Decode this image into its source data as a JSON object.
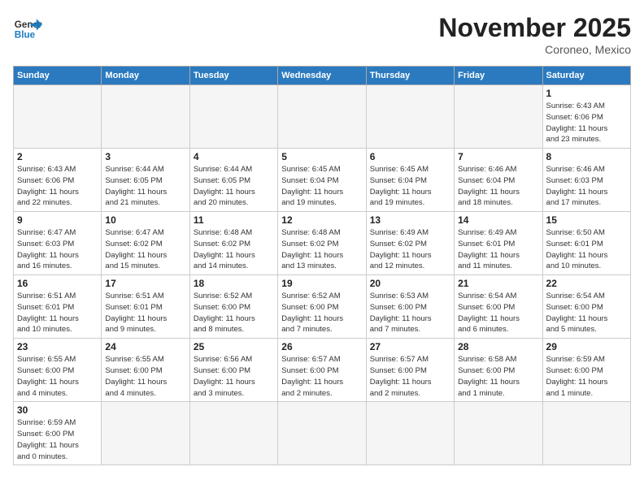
{
  "header": {
    "logo_general": "General",
    "logo_blue": "Blue",
    "month_title": "November 2025",
    "location": "Coroneo, Mexico"
  },
  "days_of_week": [
    "Sunday",
    "Monday",
    "Tuesday",
    "Wednesday",
    "Thursday",
    "Friday",
    "Saturday"
  ],
  "weeks": [
    [
      {
        "day": "",
        "info": ""
      },
      {
        "day": "",
        "info": ""
      },
      {
        "day": "",
        "info": ""
      },
      {
        "day": "",
        "info": ""
      },
      {
        "day": "",
        "info": ""
      },
      {
        "day": "",
        "info": ""
      },
      {
        "day": "1",
        "info": "Sunrise: 6:43 AM\nSunset: 6:06 PM\nDaylight: 11 hours\nand 23 minutes."
      }
    ],
    [
      {
        "day": "2",
        "info": "Sunrise: 6:43 AM\nSunset: 6:06 PM\nDaylight: 11 hours\nand 22 minutes."
      },
      {
        "day": "3",
        "info": "Sunrise: 6:44 AM\nSunset: 6:05 PM\nDaylight: 11 hours\nand 21 minutes."
      },
      {
        "day": "4",
        "info": "Sunrise: 6:44 AM\nSunset: 6:05 PM\nDaylight: 11 hours\nand 20 minutes."
      },
      {
        "day": "5",
        "info": "Sunrise: 6:45 AM\nSunset: 6:04 PM\nDaylight: 11 hours\nand 19 minutes."
      },
      {
        "day": "6",
        "info": "Sunrise: 6:45 AM\nSunset: 6:04 PM\nDaylight: 11 hours\nand 19 minutes."
      },
      {
        "day": "7",
        "info": "Sunrise: 6:46 AM\nSunset: 6:04 PM\nDaylight: 11 hours\nand 18 minutes."
      },
      {
        "day": "8",
        "info": "Sunrise: 6:46 AM\nSunset: 6:03 PM\nDaylight: 11 hours\nand 17 minutes."
      }
    ],
    [
      {
        "day": "9",
        "info": "Sunrise: 6:47 AM\nSunset: 6:03 PM\nDaylight: 11 hours\nand 16 minutes."
      },
      {
        "day": "10",
        "info": "Sunrise: 6:47 AM\nSunset: 6:02 PM\nDaylight: 11 hours\nand 15 minutes."
      },
      {
        "day": "11",
        "info": "Sunrise: 6:48 AM\nSunset: 6:02 PM\nDaylight: 11 hours\nand 14 minutes."
      },
      {
        "day": "12",
        "info": "Sunrise: 6:48 AM\nSunset: 6:02 PM\nDaylight: 11 hours\nand 13 minutes."
      },
      {
        "day": "13",
        "info": "Sunrise: 6:49 AM\nSunset: 6:02 PM\nDaylight: 11 hours\nand 12 minutes."
      },
      {
        "day": "14",
        "info": "Sunrise: 6:49 AM\nSunset: 6:01 PM\nDaylight: 11 hours\nand 11 minutes."
      },
      {
        "day": "15",
        "info": "Sunrise: 6:50 AM\nSunset: 6:01 PM\nDaylight: 11 hours\nand 10 minutes."
      }
    ],
    [
      {
        "day": "16",
        "info": "Sunrise: 6:51 AM\nSunset: 6:01 PM\nDaylight: 11 hours\nand 10 minutes."
      },
      {
        "day": "17",
        "info": "Sunrise: 6:51 AM\nSunset: 6:01 PM\nDaylight: 11 hours\nand 9 minutes."
      },
      {
        "day": "18",
        "info": "Sunrise: 6:52 AM\nSunset: 6:00 PM\nDaylight: 11 hours\nand 8 minutes."
      },
      {
        "day": "19",
        "info": "Sunrise: 6:52 AM\nSunset: 6:00 PM\nDaylight: 11 hours\nand 7 minutes."
      },
      {
        "day": "20",
        "info": "Sunrise: 6:53 AM\nSunset: 6:00 PM\nDaylight: 11 hours\nand 7 minutes."
      },
      {
        "day": "21",
        "info": "Sunrise: 6:54 AM\nSunset: 6:00 PM\nDaylight: 11 hours\nand 6 minutes."
      },
      {
        "day": "22",
        "info": "Sunrise: 6:54 AM\nSunset: 6:00 PM\nDaylight: 11 hours\nand 5 minutes."
      }
    ],
    [
      {
        "day": "23",
        "info": "Sunrise: 6:55 AM\nSunset: 6:00 PM\nDaylight: 11 hours\nand 4 minutes."
      },
      {
        "day": "24",
        "info": "Sunrise: 6:55 AM\nSunset: 6:00 PM\nDaylight: 11 hours\nand 4 minutes."
      },
      {
        "day": "25",
        "info": "Sunrise: 6:56 AM\nSunset: 6:00 PM\nDaylight: 11 hours\nand 3 minutes."
      },
      {
        "day": "26",
        "info": "Sunrise: 6:57 AM\nSunset: 6:00 PM\nDaylight: 11 hours\nand 2 minutes."
      },
      {
        "day": "27",
        "info": "Sunrise: 6:57 AM\nSunset: 6:00 PM\nDaylight: 11 hours\nand 2 minutes."
      },
      {
        "day": "28",
        "info": "Sunrise: 6:58 AM\nSunset: 6:00 PM\nDaylight: 11 hours\nand 1 minute."
      },
      {
        "day": "29",
        "info": "Sunrise: 6:59 AM\nSunset: 6:00 PM\nDaylight: 11 hours\nand 1 minute."
      }
    ],
    [
      {
        "day": "30",
        "info": "Sunrise: 6:59 AM\nSunset: 6:00 PM\nDaylight: 11 hours\nand 0 minutes."
      },
      {
        "day": "",
        "info": ""
      },
      {
        "day": "",
        "info": ""
      },
      {
        "day": "",
        "info": ""
      },
      {
        "day": "",
        "info": ""
      },
      {
        "day": "",
        "info": ""
      },
      {
        "day": "",
        "info": ""
      }
    ]
  ]
}
